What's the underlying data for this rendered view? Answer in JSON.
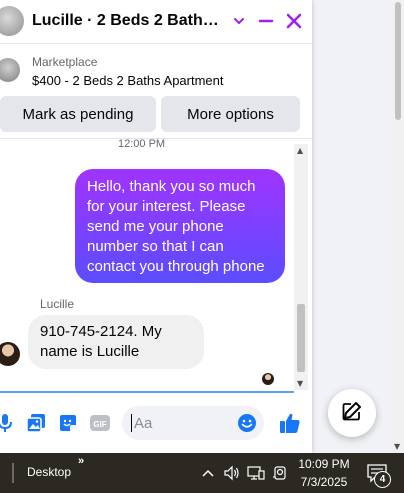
{
  "chat_header": {
    "title": "Lucille · 2 Beds 2 Baths Ap...",
    "icons": [
      "chevron-down-icon",
      "minimize-icon",
      "close-icon"
    ]
  },
  "listing": {
    "source": "Marketplace",
    "item": "$400 - 2 Beds 2 Baths Apartment"
  },
  "actions": {
    "pending_label": "Mark as pending",
    "more_label": "More options"
  },
  "conversation": {
    "timestamp": "12:00 PM",
    "outgoing": "Hello, thank you so much for your interest. Please send me your phone number so that I can contact you through phone",
    "sender": "Lucille",
    "incoming": "910-745-2124. My name is Lucille"
  },
  "composer": {
    "placeholder": "Aa",
    "icons": [
      "microphone-icon",
      "photo-icon",
      "sticker-icon",
      "gif-icon",
      "emoji-icon",
      "thumbs-up-icon"
    ],
    "gif_label": "GIF"
  },
  "floating": {
    "icon": "compose-icon"
  },
  "taskbar": {
    "desktop_label": "Desktop",
    "chevron": "»",
    "time": "10:09 PM",
    "date": "7/3/2025",
    "notification_count": "4",
    "icons": [
      "chevron-up-icon",
      "speaker-icon",
      "network-icon",
      "camera-icon",
      "notification-icon"
    ]
  },
  "colors": {
    "accent": "#1877f2",
    "close": "#a020f0",
    "bubble_top": "#a033ff",
    "bubble_bottom": "#5b4dff",
    "taskbar": "#2b2922"
  }
}
